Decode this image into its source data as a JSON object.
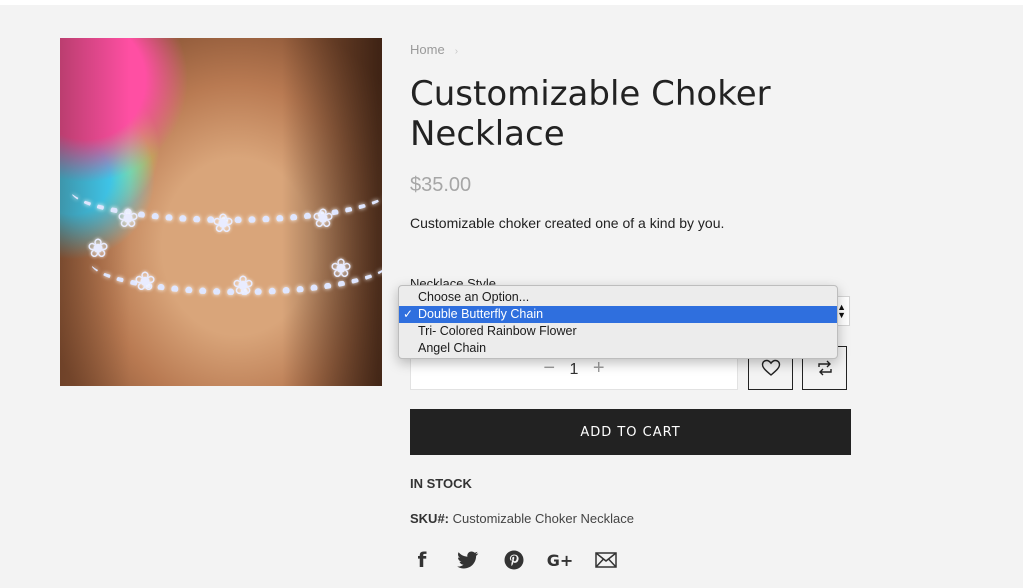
{
  "breadcrumb": {
    "home": "Home",
    "separator": "›"
  },
  "product": {
    "title": "Customizable Choker Necklace",
    "price": "$35.00",
    "description": "Customizable choker created one of a kind by you.",
    "image_alt": "Butterfly choker necklace"
  },
  "option": {
    "label": "Necklace Style",
    "options": [
      {
        "label": "Choose an Option...",
        "selected": false
      },
      {
        "label": "Double Butterfly Chain",
        "selected": true
      },
      {
        "label": "Tri- Colored Rainbow Flower",
        "selected": false
      },
      {
        "label": "Angel Chain",
        "selected": false
      }
    ]
  },
  "quantity": {
    "minus": "−",
    "value": "1",
    "plus": "+"
  },
  "actions": {
    "add_to_cart": "ADD TO CART",
    "wishlist_icon": "heart-icon",
    "compare_icon": "compare-icon"
  },
  "stock": {
    "status": "IN STOCK"
  },
  "sku": {
    "label": "SKU#:",
    "value": " Customizable Choker Necklace"
  },
  "social": [
    "facebook-icon",
    "twitter-icon",
    "pinterest-icon",
    "google-plus-icon",
    "email-icon"
  ],
  "colors": {
    "button_bg": "#222222",
    "selected_option": "#2f6fde",
    "price": "#a6a6a6",
    "background": "#f3f3f3"
  }
}
